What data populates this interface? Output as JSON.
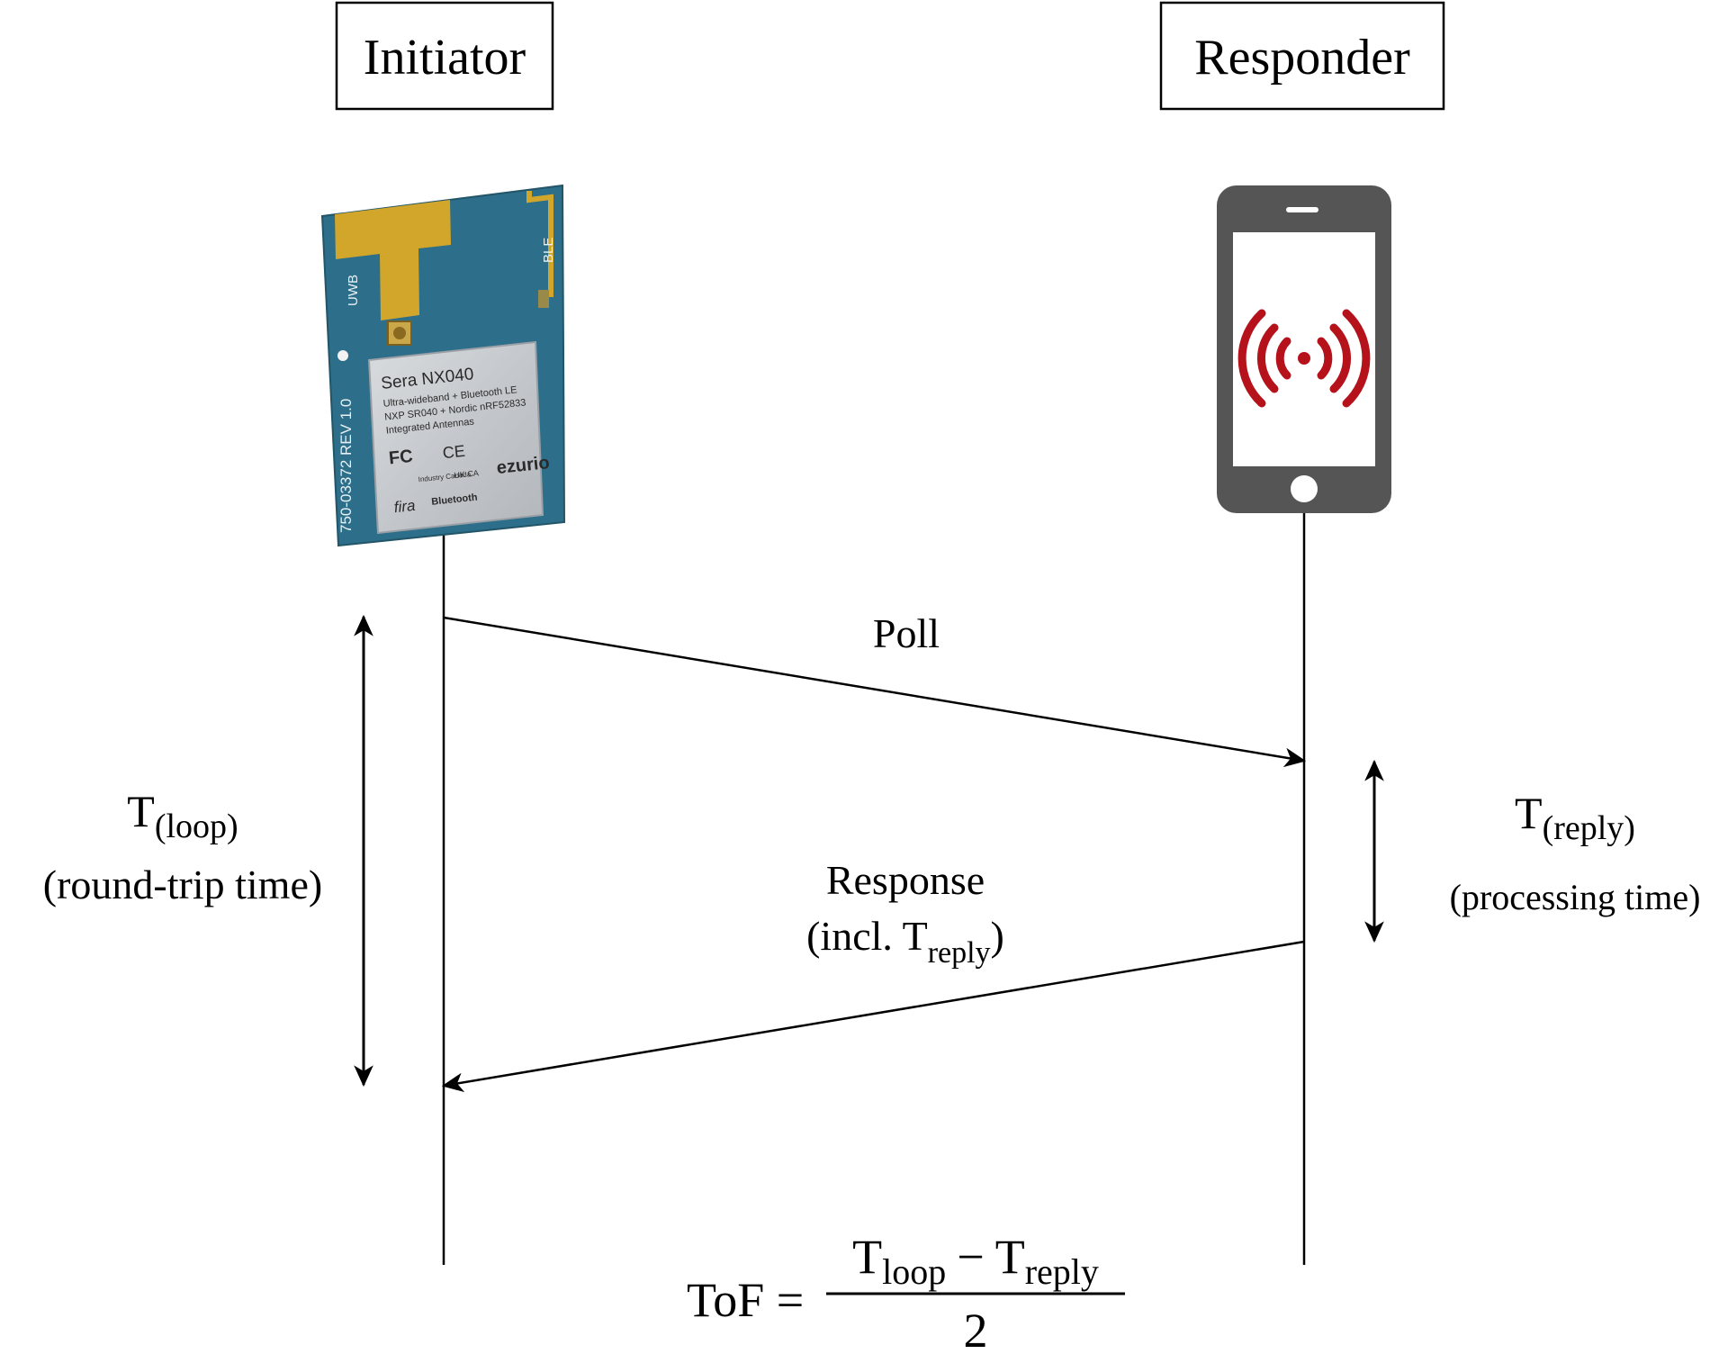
{
  "initiator": {
    "label": "Initiator",
    "module": {
      "uwb_label": "UWB",
      "ble_label": "BLE",
      "board_id": "750-03372 REV 1.0",
      "chip_title": "Sera NX040",
      "chip_line1": "Ultra-wideband + Bluetooth LE",
      "chip_line2": "NXP SR040 + Nordic nRF52833",
      "chip_line3": "Integrated Antennas",
      "cert_fc": "FC",
      "cert_ce": "CE",
      "cert_industry": "Industry Canada",
      "cert_ukca": "UK CA",
      "brand": "ezurio",
      "fira": "fira",
      "bluetooth": "Bluetooth"
    }
  },
  "responder": {
    "label": "Responder",
    "device_icon": "smartphone-icon",
    "signal_icon": "wireless-signal-icon",
    "signal_color": "#b5121b"
  },
  "messages": {
    "poll": "Poll",
    "response_line1": "Response",
    "response_line2_prefix": "(incl. T",
    "response_line2_sub": "reply",
    "response_line2_suffix": ")"
  },
  "timing": {
    "loop_T": "T",
    "loop_sub": "(loop)",
    "loop_desc": "(round-trip time)",
    "reply_T": "T",
    "reply_sub": "(reply)",
    "reply_desc": "(processing time)"
  },
  "formula": {
    "lhs": "ToF =",
    "num_T1": "T",
    "num_sub1": "loop",
    "minus": "−",
    "num_T2": "T",
    "num_sub2": "reply",
    "denominator": "2"
  },
  "colors": {
    "pcb": "#2d6e8a",
    "antenna_gold": "#d2a62a",
    "phone_body": "#555555"
  }
}
